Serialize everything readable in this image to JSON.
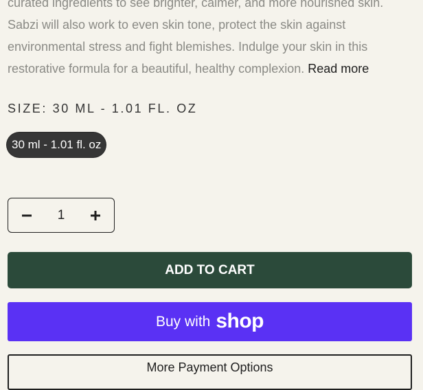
{
  "description": {
    "text": "curated ingredients to see brighter, calmer, and more nourished skin. Sabzi will also work to even skin tone, protect the skin against environmental stress and fight blemishes. Indulge your skin in this restorative formula for a beautiful, healthy complexion. ",
    "read_more": "Read more"
  },
  "size": {
    "label": "SIZE: 30 ML - 1.01 FL. OZ",
    "selected_option": "30 ml - 1.01 fl. oz"
  },
  "quantity": {
    "value": "1",
    "decrease_icon": "minus-icon",
    "increase_icon": "plus-icon"
  },
  "actions": {
    "add_to_cart": "ADD TO CART",
    "buy_with": "Buy with",
    "shop_brand": "shop",
    "more_payment": "More Payment Options"
  },
  "colors": {
    "background": "#f5f3ec",
    "add_to_cart": "#2b4a3a",
    "shop_pay": "#5a31f4",
    "selected_pill": "#363636"
  }
}
